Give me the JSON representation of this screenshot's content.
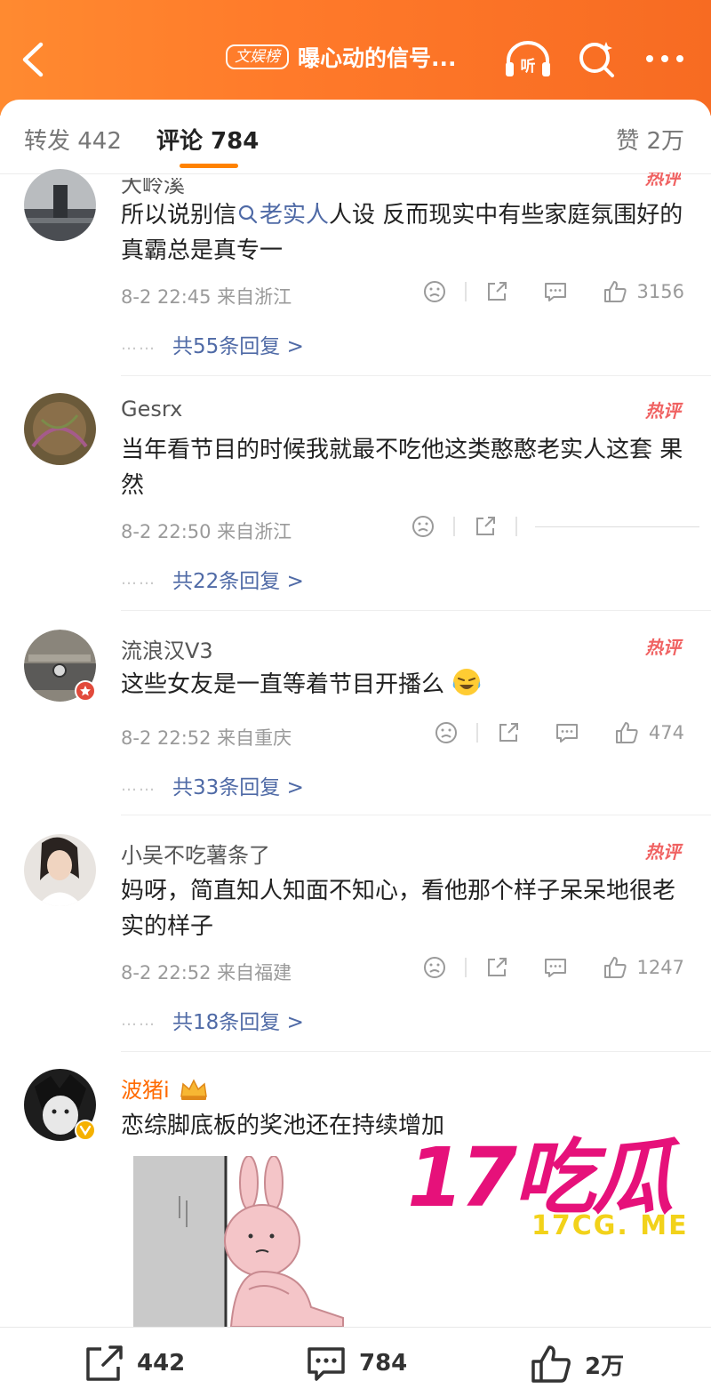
{
  "header": {
    "badge": "文娱榜",
    "title": "曝心动的信号...",
    "listen_label": "听"
  },
  "tabs": {
    "repost": "转发 442",
    "comment": "评论 784",
    "like": "赞 2万"
  },
  "comments": [
    {
      "author": "大岭溪",
      "hot": "热评",
      "text_prefix": "所以说别信",
      "topic": "老实人",
      "text_suffix": "人设 反而现实中有些家庭氛围好的真霸总是真专一",
      "meta": "8-2 22:45 来自浙江",
      "likes": "3156",
      "replies": "共55条回复 >"
    },
    {
      "author": "Gesrx",
      "hot": "热评",
      "text": "当年看节目的时候我就最不吃他这类憨憨老实人这套 果然",
      "meta": "8-2 22:50 来自浙江",
      "likes": "",
      "replies": "共22条回复 >"
    },
    {
      "author": "流浪汉V3",
      "hot": "热评",
      "text": "这些女友是一直等着节目开播么",
      "meta": "8-2 22:52 来自重庆",
      "likes": "474",
      "replies": "共33条回复 >"
    },
    {
      "author": "小吴不吃薯条了",
      "hot": "热评",
      "text": "妈呀，简直知人知面不知心，看他那个样子呆呆地很老实的样子",
      "meta": "8-2 22:52 来自福建",
      "likes": "1247",
      "replies": "共18条回复 >"
    },
    {
      "author": "波猪i",
      "text": "恋综脚底板的奖池还在持续增加"
    }
  ],
  "reply_dots": "……",
  "watermark": {
    "big": "17吃瓜",
    "small": "17CG. ME"
  },
  "bottom": {
    "repost": "442",
    "comment": "784",
    "like": "2万"
  },
  "colors": {
    "header": "#ff7a2a",
    "accent": "#ff8200",
    "link": "#4f6aa6",
    "hot": "#f06262",
    "watermark": "#e6117a"
  }
}
